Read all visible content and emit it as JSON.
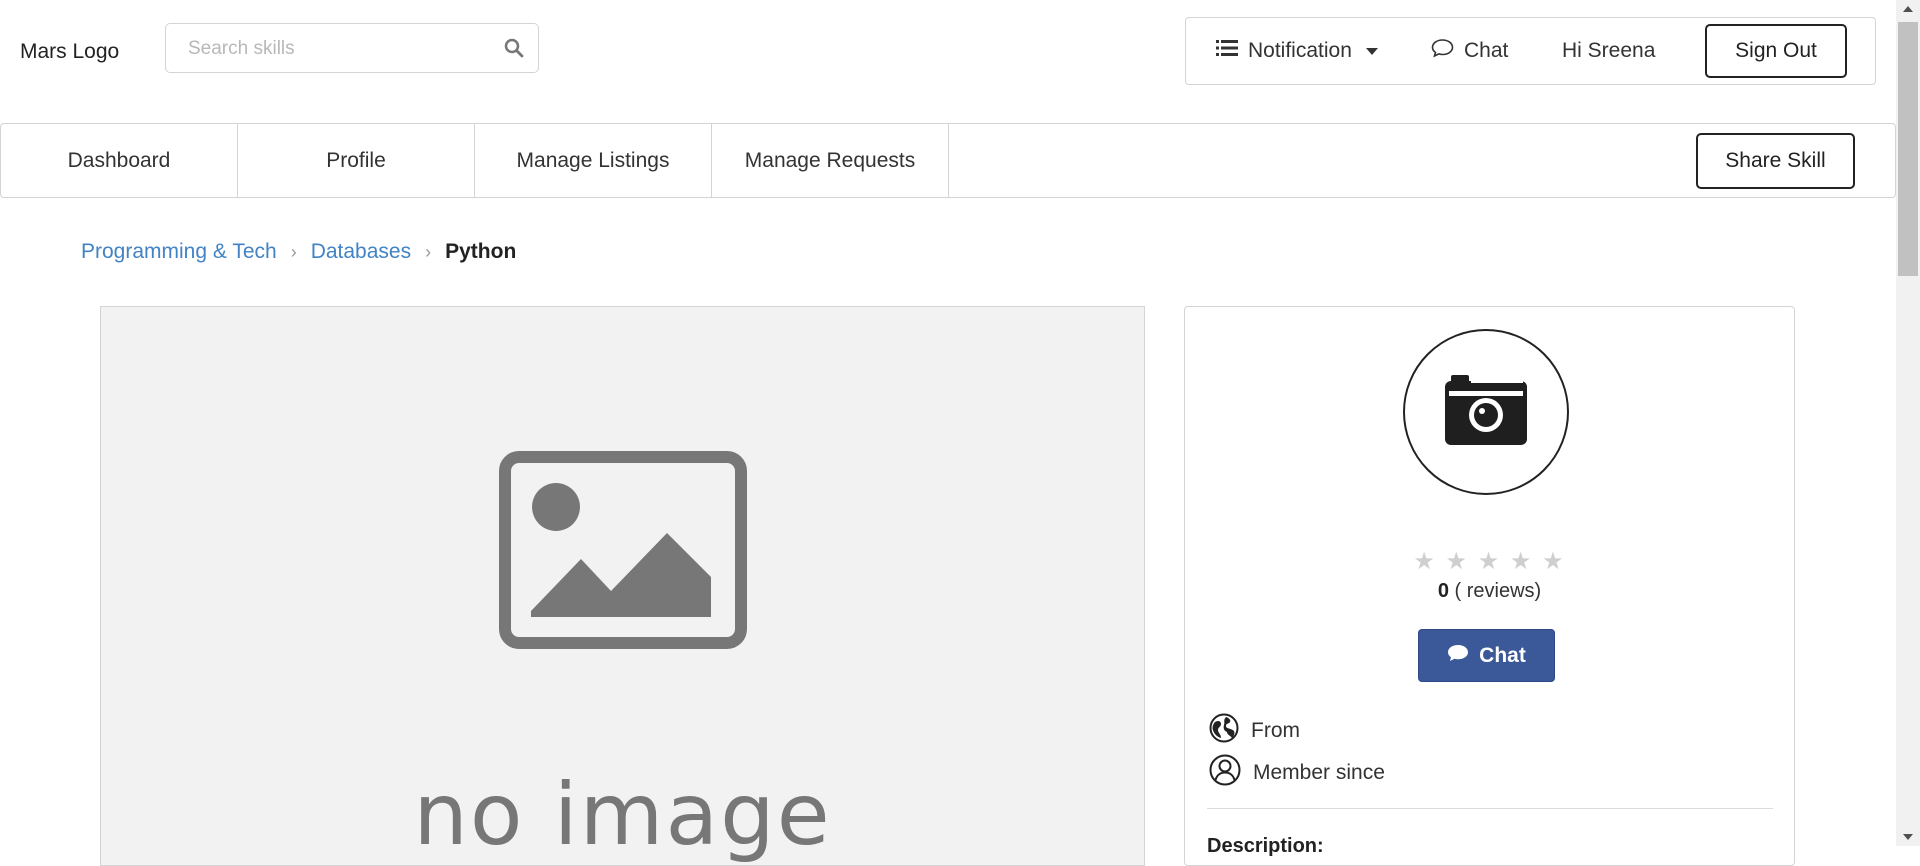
{
  "header": {
    "logo": "Mars Logo",
    "search_placeholder": "Search skills",
    "search_icon": "search-icon",
    "notification_label": "Notification",
    "notification_icon": "list-icon",
    "chat_label": "Chat",
    "chat_icon": "comment-outline-icon",
    "greeting": "Hi Sreena",
    "signout_label": "Sign Out"
  },
  "nav": {
    "tabs": [
      {
        "label": "Dashboard"
      },
      {
        "label": "Profile"
      },
      {
        "label": "Manage Listings"
      },
      {
        "label": "Manage Requests"
      }
    ],
    "share_label": "Share Skill"
  },
  "breadcrumb": {
    "items": [
      "Programming & Tech",
      "Databases"
    ],
    "current": "Python"
  },
  "listing": {
    "image_text": "no image"
  },
  "seller": {
    "avatar_icon": "camera-icon",
    "rating": "0",
    "reviews_label": "( reviews)",
    "stars_count": 5,
    "stars_filled": 0,
    "chat_label": "Chat",
    "from_label": "From",
    "member_label": "Member since",
    "description_label": "Description:"
  },
  "colors": {
    "link": "#4183c4",
    "chat_button": "#3b5998",
    "border": "#d4d4d5"
  }
}
